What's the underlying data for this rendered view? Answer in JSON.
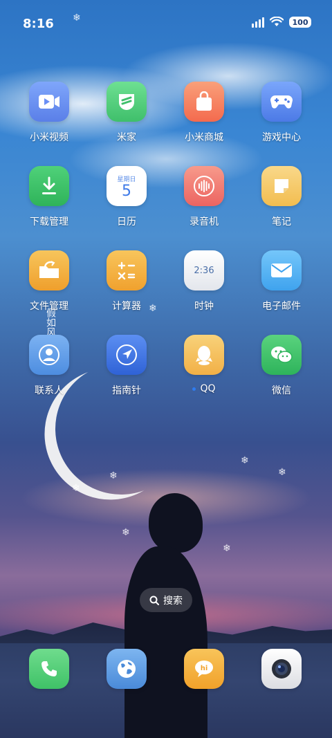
{
  "status_bar": {
    "time": "8:16",
    "battery": "100"
  },
  "apps": [
    {
      "label": "小米视频",
      "icon": "video-play-icon",
      "color": "#6a8ff5"
    },
    {
      "label": "米家",
      "icon": "mijia-shield-icon",
      "color": "#55cf80"
    },
    {
      "label": "小米商城",
      "icon": "shopping-bag-icon",
      "color": "#f7805a"
    },
    {
      "label": "游戏中心",
      "icon": "gamepad-icon",
      "color": "#5c8df2"
    },
    {
      "label": "下载管理",
      "icon": "download-arrow-icon",
      "color": "#37c063"
    },
    {
      "label": "日历",
      "icon": "calendar-icon",
      "color": "#ffffff",
      "calendar_weekday": "星期日",
      "calendar_day": "5"
    },
    {
      "label": "录音机",
      "icon": "sound-wave-icon",
      "color": "#f0706b"
    },
    {
      "label": "笔记",
      "icon": "note-icon",
      "color": "#f7cb6c"
    },
    {
      "label": "文件管理",
      "icon": "folder-icon",
      "color": "#f3b440"
    },
    {
      "label": "计算器",
      "icon": "calculator-icon",
      "color": "#f4b33c"
    },
    {
      "label": "时钟",
      "icon": "clock-icon",
      "color": "#f2f3f5",
      "clock_time": "2:36"
    },
    {
      "label": "电子邮件",
      "icon": "mail-envelope-icon",
      "color": "#5ab3f2"
    },
    {
      "label": "联系人",
      "icon": "contact-person-icon",
      "color": "#5b9be8"
    },
    {
      "label": "指南针",
      "icon": "compass-arrow-icon",
      "color": "#3f73e8"
    },
    {
      "label": "QQ",
      "icon": "qq-penguin-icon",
      "color": "#f5c15a",
      "badge_dot": true
    },
    {
      "label": "微信",
      "icon": "wechat-bubbles-icon",
      "color": "#3ec46a"
    }
  ],
  "overlay_poem": "假如风有方",
  "search": {
    "label": "搜索"
  },
  "dock": [
    {
      "name": "phone",
      "icon": "phone-icon",
      "color": "#4ecb73"
    },
    {
      "name": "browser",
      "icon": "globe-icon",
      "color": "#5d9be6"
    },
    {
      "name": "messages",
      "icon": "hi-bubble-icon",
      "color": "#f6b23a"
    },
    {
      "name": "camera",
      "icon": "camera-lens-icon",
      "color": "#f0f0f2"
    }
  ]
}
